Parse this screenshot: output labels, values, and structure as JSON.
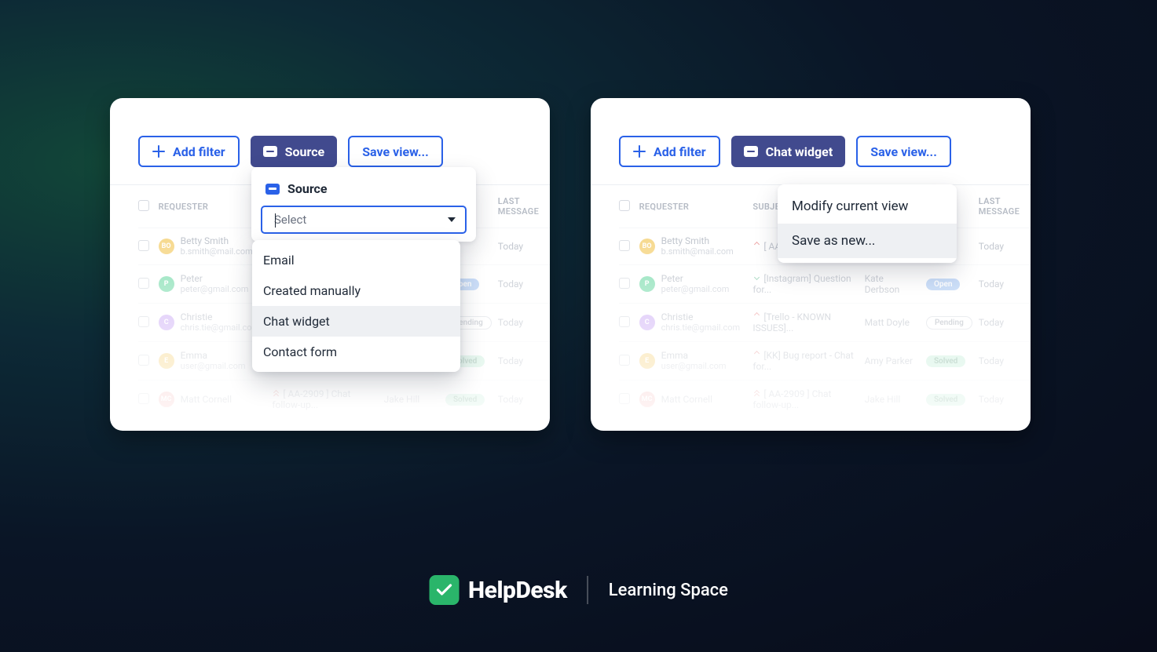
{
  "toolbar": {
    "add_filter": "Add filter",
    "source_btn_left": "Source",
    "source_btn_right": "Chat widget",
    "save_view": "Save view..."
  },
  "columns": {
    "requester": "REQUESTER",
    "subject_short": "S",
    "subject": "SUBJECT",
    "assignee_short": "",
    "last_message": "LAST MESSAGE"
  },
  "source_popover": {
    "title": "Source",
    "select_placeholder": "Select",
    "options": [
      "Email",
      "Created manually",
      "Chat widget",
      "Contact form"
    ],
    "hover_index": 2
  },
  "saveview_popover": {
    "options": [
      "Modify current view",
      "Save as new..."
    ],
    "hover_index": 1
  },
  "rows": [
    {
      "avatar": "bo",
      "avatar_label": "BO",
      "name": "Betty Smith",
      "email": "b.smith@mail.com",
      "arrow": "up",
      "subject": "[ AA-2909 ]",
      "assignee": "",
      "status": "",
      "last": "Today"
    },
    {
      "avatar": "p",
      "avatar_label": "P",
      "name": "Peter",
      "email": "peter@gmail.com",
      "arrow": "down",
      "subject": "[Instagram] Question for...",
      "assignee": "Kate Derbson",
      "status": "Open",
      "last": "Today"
    },
    {
      "avatar": "c",
      "avatar_label": "C",
      "name": "Christie",
      "email": "chris.tie@gmail.com",
      "arrow": "up",
      "subject": "[Trello - KNOWN ISSUES]...",
      "assignee": "Matt Doyle",
      "status": "Pending",
      "last": "Today"
    },
    {
      "avatar": "e",
      "avatar_label": "E",
      "name": "Emma",
      "email": "user@gmail.com",
      "arrow": "up",
      "subject": "[KK] Bug report - Chat for...",
      "assignee": "Amy Parker",
      "status": "Solved",
      "last": "Today"
    },
    {
      "avatar": "mc",
      "avatar_label": "MC",
      "name": "Matt Cornell",
      "email": "",
      "arrow": "up2",
      "subject": "[ AA-2909 ] Chat follow-up...",
      "assignee": "Jake Hill",
      "status": "Solved",
      "last": "Today"
    }
  ],
  "brand": {
    "name": "HelpDesk",
    "subtitle": "Learning Space"
  }
}
